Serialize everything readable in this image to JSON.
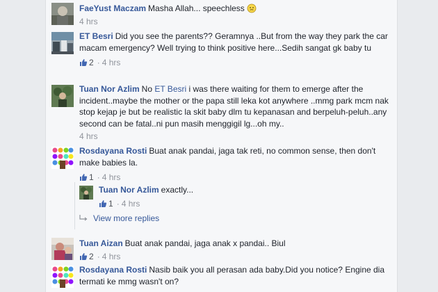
{
  "comments": [
    {
      "name": "FaeYust Maczam",
      "text": "Masha Allah... speechless",
      "emoji": "neutral-face-emoji",
      "time": "4 hrs"
    },
    {
      "name": "ET Besri",
      "text": "Did you see the parents?? Geramnya ..But from the way they park the car macam emergency? Well trying to think positive here...Sedih sangat gk baby tu",
      "likes": "2",
      "time": "4 hrs"
    },
    {
      "name": "Tuan Nor Azlim",
      "pre_tag": "No",
      "tag": "ET Besri",
      "text": "i was there waiting for them to emerge after the incident..maybe the mother or the papa still leka kot anywhere ..mmg park mcm nak stop kejap je but be realistic la skit baby dlm tu kepanasan and berpeluh-peluh..any second can be fatal..ni pun masih menggigil lg...oh my..",
      "time": "4 hrs"
    },
    {
      "name": "Rosdayana Rosti",
      "text": "Buat anak pandai, jaga tak reti, no common sense, then don't make babies la.",
      "likes": "1",
      "time": "4 hrs"
    },
    {
      "name": "Tuan Nor Azlim",
      "text": "exactly...",
      "likes": "1",
      "time": "4 hrs"
    },
    {
      "name": "Tuan Aizan",
      "text": "Buat anak pandai, jaga anak x pandai.. Biul",
      "likes": "2",
      "time": "4 hrs"
    },
    {
      "name": "Rosdayana Rosti",
      "text": "Nasib baik you all perasan ada baby.Did you notice? Engine dia termati ke mmg wasn't on?"
    }
  ],
  "view_more": "View more replies",
  "colors": {
    "link": "#365899",
    "text": "#1d2129",
    "meta": "#90949c",
    "like": "#4267b2",
    "panel": "#f6f7f9",
    "page": "#e9ebee"
  }
}
